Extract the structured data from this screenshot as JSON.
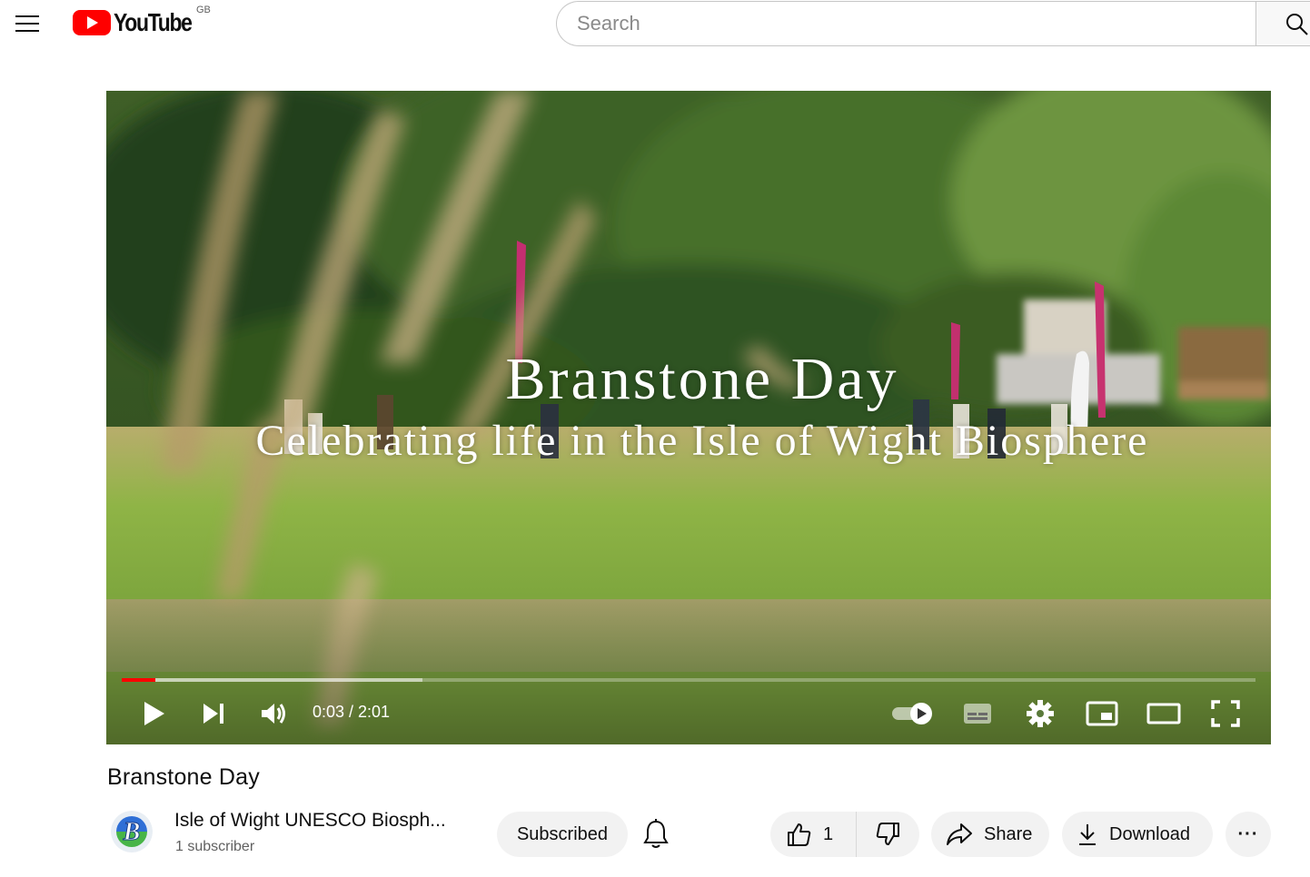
{
  "header": {
    "menu_icon": "hamburger-menu-icon",
    "logo_text": "YouTube",
    "country_code": "GB",
    "search_placeholder": "Search",
    "search_icon": "search-icon"
  },
  "player": {
    "overlay_title": "Branstone Day",
    "overlay_subtitle": "Celebrating life in the Isle of Wight Biosphere",
    "time_display": "0:03 / 2:01",
    "progress_played": 0.03,
    "progress_buffered": 0.265,
    "icons": {
      "play": "play-icon",
      "next": "next-icon",
      "volume": "volume-icon",
      "autoplay": "autoplay-toggle-icon",
      "subtitles": "subtitles-icon",
      "settings": "gear-icon",
      "miniplayer": "miniplayer-icon",
      "theater": "theater-mode-icon",
      "fullscreen": "fullscreen-icon"
    },
    "accent_color": "#ff0000"
  },
  "video": {
    "title": "Branstone Day",
    "channel_name": "Isle of Wight UNESCO Biosph...",
    "subscriber_count": "1 subscriber",
    "avatar_letter": "B",
    "subscribe_label": "Subscribed",
    "like_count": "1",
    "share_label": "Share",
    "download_label": "Download",
    "more_label": "···"
  }
}
